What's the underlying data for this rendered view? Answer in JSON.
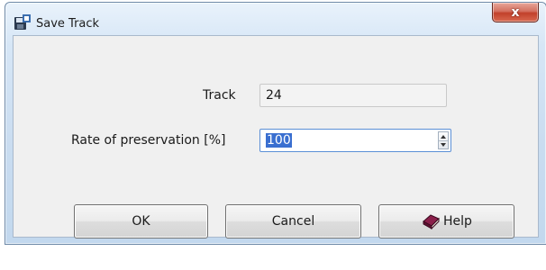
{
  "window": {
    "title": "Save Track",
    "title_icon": "save-disk-icon",
    "close_glyph": "x"
  },
  "form": {
    "track_label": "Track",
    "track_value": "24",
    "rate_label": "Rate of preservation [%]",
    "rate_value": "100"
  },
  "buttons": {
    "ok_label": "OK",
    "cancel_label": "Cancel",
    "help_label": "Help",
    "help_icon": "help-book-icon"
  },
  "colors": {
    "selection": "#3a6fd0",
    "close_button": "#c2412b"
  }
}
